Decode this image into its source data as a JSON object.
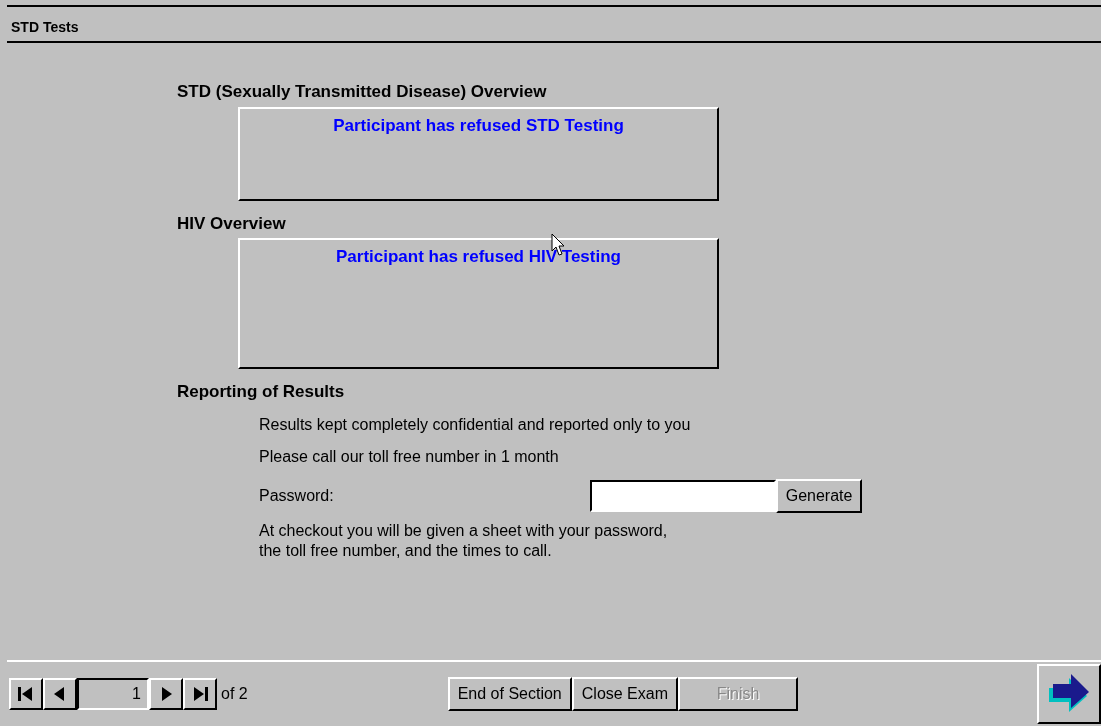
{
  "window": {
    "title": "STD Tests"
  },
  "sections": [
    {
      "heading": "STD (Sexually Transmitted Disease) Overview",
      "message": "Participant has refused STD Testing"
    },
    {
      "heading": "HIV Overview",
      "message": "Participant has refused HIV Testing"
    }
  ],
  "reporting": {
    "heading": "Reporting of Results",
    "lines": [
      "Results kept completely confidential and reported only to you",
      "Please call our toll free number in 1 month"
    ],
    "password": {
      "label": "Password:",
      "button": "Generate"
    },
    "note": "At checkout you will be given a sheet with your password,\nthe toll free number, and the times to call."
  },
  "footer": {
    "nav": [
      {
        "kind": "first"
      },
      {
        "kind": "prev"
      },
      {
        "kind": "page",
        "value": "1"
      },
      {
        "kind": "next"
      },
      {
        "kind": "last"
      }
    ],
    "page_count": "of 2",
    "buttons": [
      {
        "label": "End of Section",
        "disabled": false
      },
      {
        "label": "Close Exam",
        "disabled": false
      },
      {
        "label": "Finish",
        "disabled": true
      }
    ]
  }
}
